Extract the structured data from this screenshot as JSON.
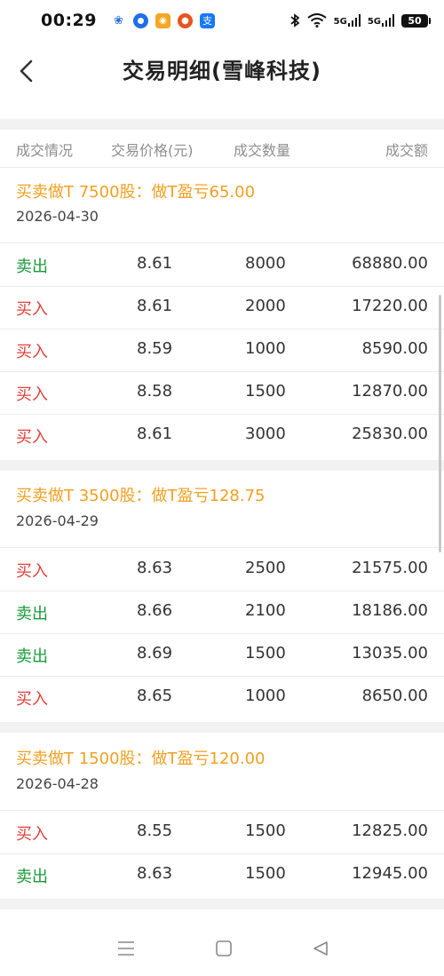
{
  "status_bar": {
    "time": "00:29",
    "battery": "50",
    "network_label": "5G"
  },
  "header": {
    "title": "交易明细(雪峰科技)"
  },
  "columns": [
    "成交情况",
    "交易价格(元)",
    "成交数量",
    "成交额"
  ],
  "groups": [
    {
      "title": "买卖做T 7500股：做T盈亏65.00",
      "date": "2026-04-30",
      "rows": [
        {
          "type": "卖出",
          "side": "sell",
          "price": "8.61",
          "qty": "8000",
          "amount": "68880.00"
        },
        {
          "type": "买入",
          "side": "buy",
          "price": "8.61",
          "qty": "2000",
          "amount": "17220.00"
        },
        {
          "type": "买入",
          "side": "buy",
          "price": "8.59",
          "qty": "1000",
          "amount": "8590.00"
        },
        {
          "type": "买入",
          "side": "buy",
          "price": "8.58",
          "qty": "1500",
          "amount": "12870.00"
        },
        {
          "type": "买入",
          "side": "buy",
          "price": "8.61",
          "qty": "3000",
          "amount": "25830.00"
        }
      ]
    },
    {
      "title": "买卖做T 3500股：做T盈亏128.75",
      "date": "2026-04-29",
      "rows": [
        {
          "type": "买入",
          "side": "buy",
          "price": "8.63",
          "qty": "2500",
          "amount": "21575.00"
        },
        {
          "type": "卖出",
          "side": "sell",
          "price": "8.66",
          "qty": "2100",
          "amount": "18186.00"
        },
        {
          "type": "卖出",
          "side": "sell",
          "price": "8.69",
          "qty": "1500",
          "amount": "13035.00"
        },
        {
          "type": "买入",
          "side": "buy",
          "price": "8.65",
          "qty": "1000",
          "amount": "8650.00"
        }
      ]
    },
    {
      "title": "买卖做T 1500股：做T盈亏120.00",
      "date": "2026-04-28",
      "rows": [
        {
          "type": "买入",
          "side": "buy",
          "price": "8.55",
          "qty": "1500",
          "amount": "12825.00"
        },
        {
          "type": "卖出",
          "side": "sell",
          "price": "8.63",
          "qty": "1500",
          "amount": "12945.00"
        }
      ]
    }
  ],
  "colors": {
    "buy": "#e0403c",
    "sell": "#1a9a3a",
    "group_title": "#f0a020",
    "header_text": "#8e8e8e"
  },
  "icons": [
    "back-arrow-icon",
    "menu-icon",
    "home-icon",
    "back-triangle-icon",
    "bluetooth-icon",
    "wifi-icon",
    "signal-icon",
    "battery-icon"
  ]
}
